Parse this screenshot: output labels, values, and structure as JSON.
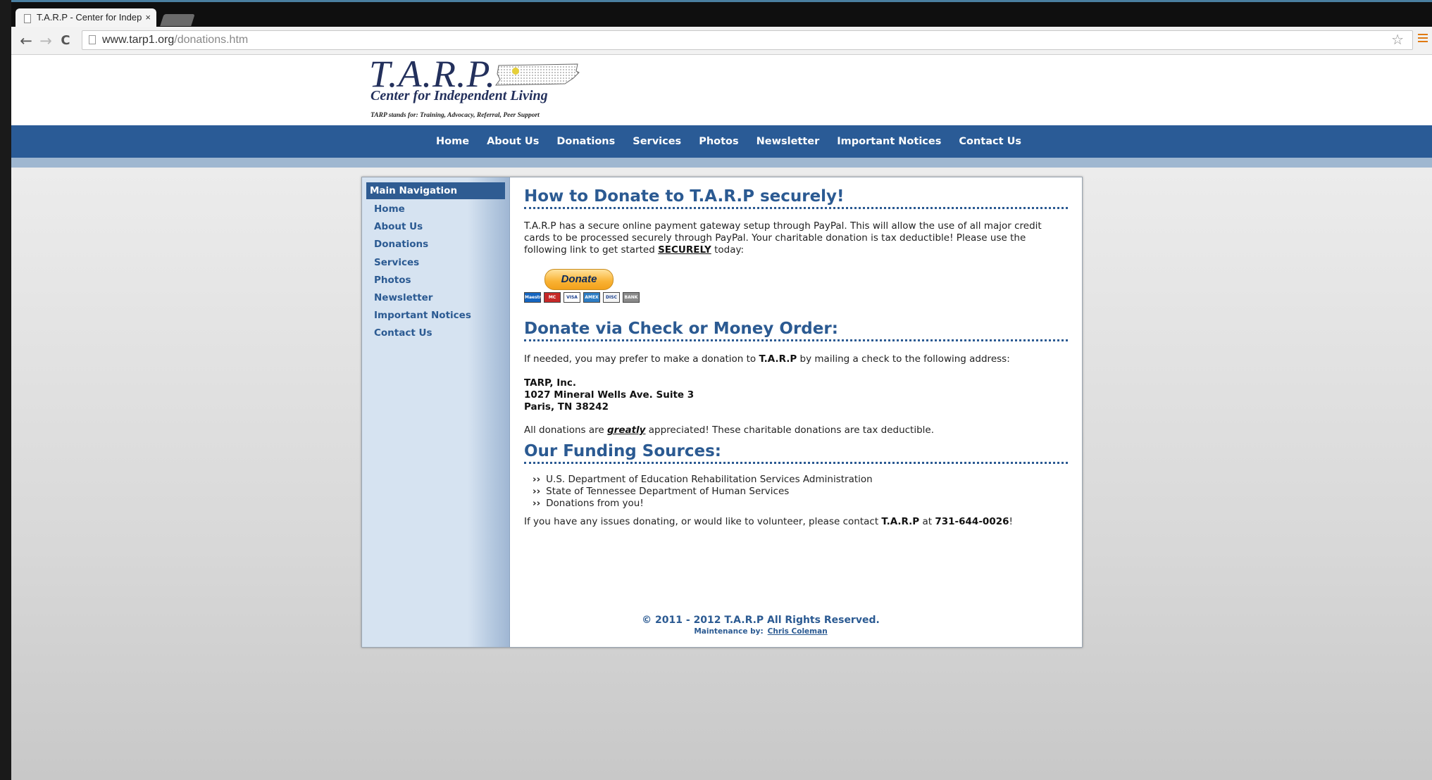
{
  "browser": {
    "tab_title": "T.A.R.P - Center for Indep",
    "tab_close": "×",
    "back": "←",
    "forward": "→",
    "reload": "C",
    "url_host": "www.tarp1.org",
    "url_path": "/donations.htm",
    "star": "☆"
  },
  "logo": {
    "title": "T.A.R.P.",
    "subtitle": "Center for Independent Living",
    "tagline": "TARP stands for: Training, Advocacy, Referral, Peer Support"
  },
  "topnav": [
    "Home",
    "About Us",
    "Donations",
    "Services",
    "Photos",
    "Newsletter",
    "Important Notices",
    "Contact Us"
  ],
  "sidebar": {
    "heading": "Main Navigation",
    "items": [
      "Home",
      "About Us",
      "Donations",
      "Services",
      "Photos",
      "Newsletter",
      "Important Notices",
      "Contact Us"
    ]
  },
  "paypal": {
    "heading": "How to Donate to T.A.R.P securely!",
    "text_before": "T.A.R.P has a secure online payment gateway setup through PayPal. This will allow the use of all major credit cards to be processed securely through PayPal. Your charitable donation is tax deductible! Please use the following link to get started ",
    "text_link": "SECURELY",
    "text_after": " today:",
    "donate_button": "Donate",
    "cards": [
      {
        "label": "Maestro",
        "color": "#1565c0"
      },
      {
        "label": "MC",
        "color": "#c62828"
      },
      {
        "label": "VISA",
        "color": "#ffffff"
      },
      {
        "label": "AMEX",
        "color": "#2e7dc4"
      },
      {
        "label": "DISC",
        "color": "#f5f5f5"
      },
      {
        "label": "BANK",
        "color": "#8a8a8a"
      }
    ]
  },
  "check": {
    "heading": "Donate via Check or Money Order:",
    "intro_before": "If needed, you may prefer to make a donation to ",
    "intro_bold": "T.A.R.P",
    "intro_after": " by mailing a check to the following address:",
    "address": [
      "TARP, Inc.",
      "1027 Mineral Wells Ave. Suite 3",
      "Paris, TN 38242"
    ],
    "note_before": "All donations are ",
    "note_emph": "greatly",
    "note_after": " appreciated! These charitable donations are tax deductible."
  },
  "funding": {
    "heading": "Our Funding Sources:",
    "sources": [
      "U.S. Department of Education Rehabilitation Services Administration",
      "State of Tennessee Department of Human Services",
      "Donations from you!"
    ],
    "contact_before": "If you have any issues donating, or would like to volunteer, please contact ",
    "contact_org": "T.A.R.P",
    "contact_mid": " at ",
    "contact_phone": "731-644-0026",
    "contact_after": "!"
  },
  "footer": {
    "copyright": "© 2011 - 2012 T.A.R.P All Rights Reserved.",
    "maintenance_label": "Maintenance by:",
    "maintainer": "Chris Coleman"
  }
}
